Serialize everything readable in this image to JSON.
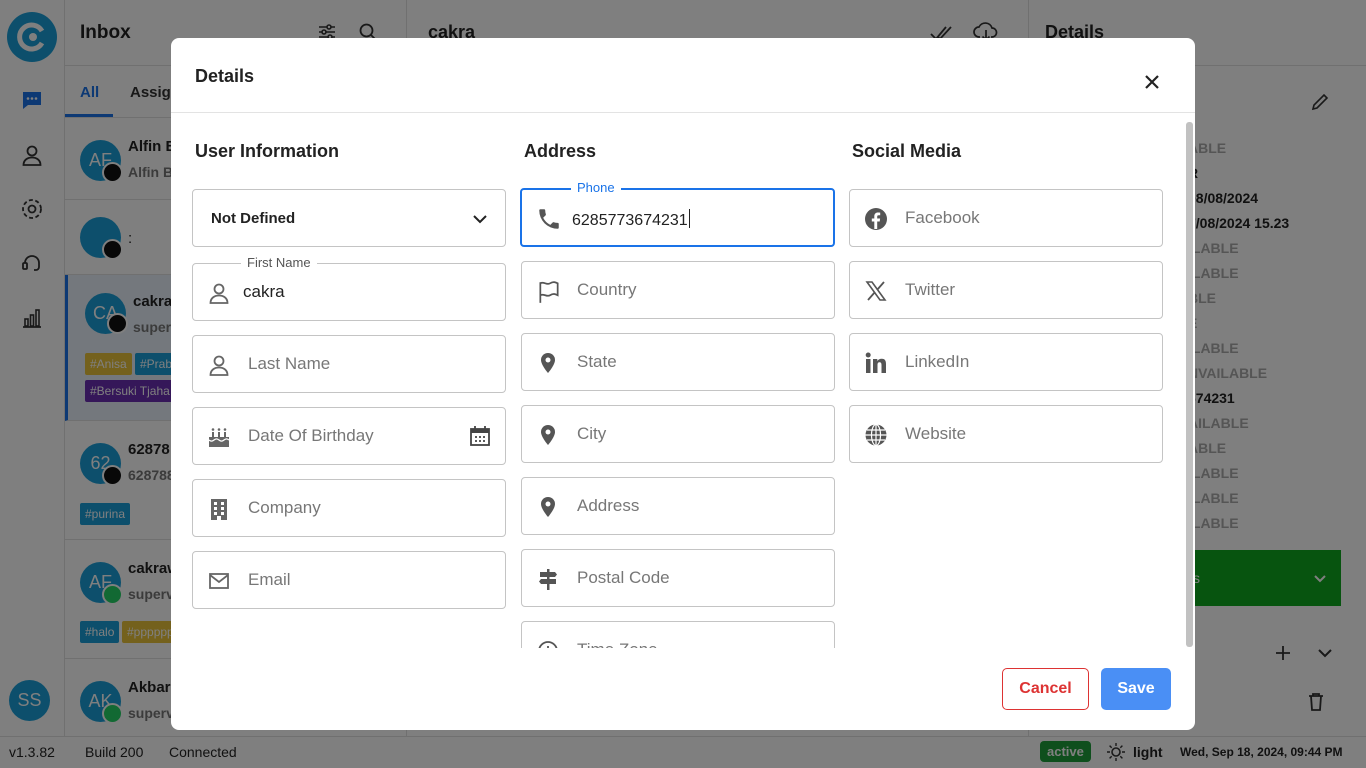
{
  "app": {
    "inbox_title": "Inbox",
    "tabs": [
      "All",
      "Assign"
    ],
    "conversation_title": "cakra",
    "details_title": "Details"
  },
  "chats": [
    {
      "initials": "AF",
      "name": "Alfin B",
      "sub": "Alfin B",
      "tags": []
    },
    {
      "initials": "",
      "name": ":",
      "sub": "",
      "tags": []
    },
    {
      "initials": "CA",
      "name": "cakra",
      "sub": "super",
      "tags": [
        "#Anisa",
        "#Prab",
        "#Bersuki Tjaha"
      ]
    },
    {
      "initials": "62",
      "name": "62878",
      "sub": "628788",
      "tags": [
        "#purina"
      ]
    },
    {
      "initials": "AF",
      "name": "cakraw",
      "sub": "superv",
      "tags": [
        "#halo",
        "#pppppp"
      ]
    },
    {
      "initials": "AK",
      "name": "Akbar",
      "sub": "superv",
      "tags": []
    }
  ],
  "details_panel": {
    "lines": [
      "ABLE",
      "R",
      "08/08/2024",
      "7/08/2024 15.23",
      "ILABLE",
      "ILABLE",
      "BLE",
      "E",
      "ILABLE",
      "NVAILABLE",
      "674231",
      "AILABLE",
      "ABLE",
      "ILABLE",
      "ILABLE",
      "ILABLE"
    ],
    "green_bar_text": "s"
  },
  "user": {
    "initials": "SS"
  },
  "statusbar": {
    "version": "v1.3.82",
    "build": "Build 200",
    "connection": "Connected",
    "status": "active",
    "theme": "light",
    "datetime": "Wed, Sep 18, 2024, 09:44 PM"
  },
  "modal": {
    "title": "Details",
    "user_info": {
      "heading": "User Information",
      "gender_select": "Not Defined",
      "first_name_label": "First Name",
      "first_name_value": "cakra",
      "last_name_placeholder": "Last Name",
      "dob_placeholder": "Date Of Birthday",
      "company_placeholder": "Company",
      "email_placeholder": "Email"
    },
    "address": {
      "heading": "Address",
      "phone_label": "Phone",
      "phone_value": "6285773674231",
      "country_placeholder": "Country",
      "state_placeholder": "State",
      "city_placeholder": "City",
      "address_placeholder": "Address",
      "postal_placeholder": "Postal Code",
      "timezone_placeholder": "Time Zone"
    },
    "social": {
      "heading": "Social Media",
      "facebook_placeholder": "Facebook",
      "twitter_placeholder": "Twitter",
      "linkedin_placeholder": "LinkedIn",
      "website_placeholder": "Website"
    },
    "cancel_label": "Cancel",
    "save_label": "Save"
  },
  "colors": {
    "accent": "#1a73e8",
    "save": "#4a8ff5",
    "cancel": "#dd3333",
    "brand": "#1a9fd8",
    "active": "#1e9e3a"
  }
}
